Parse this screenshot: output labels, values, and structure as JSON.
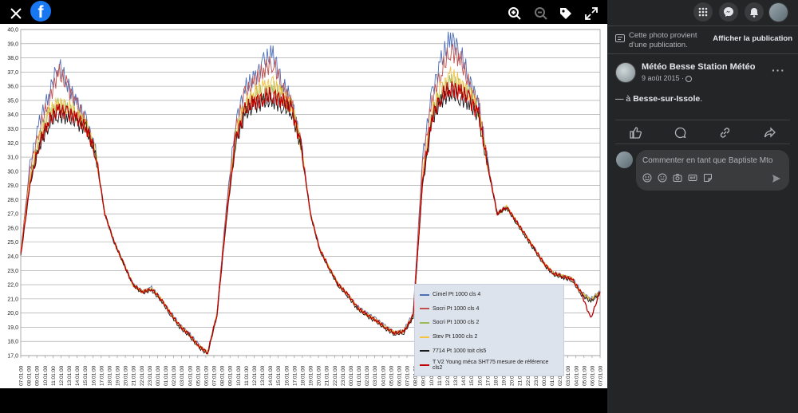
{
  "viewer": {
    "icons": [
      "close-icon",
      "facebook-logo",
      "zoom-in-icon",
      "zoom-out-icon",
      "tag-icon",
      "fullscreen-icon"
    ],
    "logo_letter": "f"
  },
  "panel": {
    "info_text": "Cette photo provient d'une publication.",
    "view_post_label": "Afficher la publication",
    "page_name": "Météo Besse Station Météo",
    "post_date": "9 août 2015 ·",
    "post_text_prefix": "— à ",
    "post_location": "Besse-sur-Issole",
    "post_text_suffix": ".",
    "more_label": "···",
    "comment_placeholder": "Commenter en tant que Baptiste Mto",
    "colors": {
      "panel_bg": "#242526",
      "input_bg": "#3a3b3c",
      "text": "#e4e6eb",
      "muted": "#b0b3b8",
      "brand": "#1877f2"
    }
  },
  "chart_data": {
    "type": "line",
    "ylim": [
      17.0,
      40.0
    ],
    "y_ticks": [
      "17,0",
      "18,0",
      "19,0",
      "20,0",
      "21,0",
      "22,0",
      "23,0",
      "24,0",
      "25,0",
      "26,0",
      "27,0",
      "28,0",
      "29,0",
      "30,0",
      "31,0",
      "32,0",
      "33,0",
      "34,0",
      "35,0",
      "36,0",
      "37,0",
      "38,0",
      "39,0",
      "40,0"
    ],
    "x_ticks": [
      "07:01:00",
      "08:01:00",
      "09:01:00",
      "10:01:00",
      "11:01:00",
      "12:01:00",
      "13:01:00",
      "14:01:00",
      "15:01:00",
      "16:01:00",
      "17:01:00",
      "18:01:00",
      "19:01:00",
      "20:01:00",
      "21:01:00",
      "22:01:00",
      "23:01:00",
      "00:01:00",
      "01:01:00",
      "02:01:00",
      "03:01:00",
      "04:01:00",
      "05:01:00",
      "06:01:00",
      "07:01:00",
      "08:01:00",
      "09:01:00",
      "10:01:00",
      "11:01:00",
      "12:01:00",
      "13:01:00",
      "14:01:00",
      "15:01:00",
      "16:01:00",
      "17:01:00",
      "18:01:00",
      "19:01:00",
      "20:01:00",
      "21:01:00",
      "22:01:00",
      "23:01:00",
      "00:01:00",
      "01:01:00",
      "02:01:00",
      "03:01:00",
      "04:01:00",
      "05:01:00",
      "06:01:00",
      "07:01:00",
      "08:01:00",
      "09:01:00",
      "10:01:00",
      "11:01:00",
      "12:01:00",
      "13:01:00",
      "14:01:00",
      "15:01:00",
      "16:01:00",
      "17:01:00",
      "18:01:00",
      "19:01:00",
      "20:01:00",
      "21:01:00",
      "22:01:00",
      "23:01:00",
      "00:01:00",
      "01:01:00",
      "02:01:00",
      "03:01:00",
      "04:01:00",
      "05:01:00",
      "06:01:00",
      "07:01:00"
    ],
    "grid": true,
    "legend_position": "bottom-right",
    "series": [
      {
        "name": "Cimel Pt 1000 cls 4",
        "color": "#4f6fb8",
        "values": [
          24.3,
          30.5,
          33.5,
          35.4,
          37.6,
          36.2,
          34.8,
          33.6,
          31.5,
          27.0,
          25.0,
          23.5,
          22.0,
          21.5,
          21.8,
          21.0,
          20.1,
          19.2,
          18.6,
          17.8,
          17.2,
          20.0,
          27.5,
          33.5,
          35.9,
          36.5,
          37.7,
          38.3,
          36.2,
          35.0,
          32.0,
          27.0,
          24.5,
          23.2,
          22.0,
          21.3,
          20.5,
          20.0,
          19.6,
          19.1,
          18.6,
          18.8,
          20.0,
          31.0,
          35.5,
          37.8,
          39.5,
          38.5,
          36.5,
          34.8,
          30.5,
          27.0,
          27.5,
          26.5,
          25.5,
          24.5,
          23.5,
          22.8,
          22.6,
          22.5,
          21.5,
          21.0,
          21.5
        ]
      },
      {
        "name": "Socri Pt 1000 cls 4",
        "color": "#c0504d",
        "values": [
          24.3,
          30.2,
          33.0,
          35.0,
          37.0,
          36.0,
          34.6,
          33.4,
          31.4,
          27.0,
          25.0,
          23.5,
          22.0,
          21.5,
          21.7,
          21.0,
          20.0,
          19.1,
          18.5,
          17.7,
          17.2,
          20.0,
          27.2,
          33.0,
          35.5,
          36.2,
          37.2,
          37.7,
          35.9,
          34.8,
          31.9,
          27.0,
          24.5,
          23.2,
          22.0,
          21.3,
          20.4,
          19.9,
          19.5,
          19.0,
          18.6,
          18.7,
          19.9,
          30.5,
          35.0,
          37.0,
          38.6,
          38.0,
          36.0,
          34.6,
          30.4,
          27.0,
          27.5,
          26.5,
          25.5,
          24.5,
          23.5,
          22.8,
          22.6,
          22.4,
          21.4,
          20.9,
          21.5
        ]
      },
      {
        "name": "Socri Pt 1000 cls 2",
        "color": "#9bbb59",
        "values": [
          24.2,
          29.5,
          32.3,
          34.0,
          34.6,
          34.4,
          34.0,
          33.2,
          31.3,
          27.0,
          25.0,
          23.5,
          22.0,
          21.5,
          21.7,
          21.0,
          20.0,
          19.1,
          18.5,
          17.7,
          17.2,
          19.9,
          26.8,
          32.5,
          34.6,
          35.3,
          35.6,
          35.8,
          35.2,
          34.5,
          31.8,
          27.0,
          24.5,
          23.2,
          22.0,
          21.3,
          20.4,
          19.9,
          19.5,
          19.0,
          18.6,
          18.7,
          19.8,
          29.5,
          34.0,
          35.6,
          36.3,
          35.9,
          35.4,
          34.2,
          30.3,
          27.0,
          27.5,
          26.5,
          25.5,
          24.5,
          23.5,
          22.8,
          22.6,
          22.4,
          21.4,
          20.9,
          21.5
        ]
      },
      {
        "name": "Stev Pt 1000 cls 2",
        "color": "#f5c342",
        "values": [
          24.2,
          29.6,
          32.4,
          34.1,
          34.8,
          34.6,
          34.1,
          33.3,
          31.3,
          27.0,
          25.0,
          23.5,
          22.0,
          21.5,
          21.7,
          21.0,
          20.0,
          19.1,
          18.5,
          17.7,
          17.2,
          19.9,
          26.9,
          32.6,
          34.8,
          35.5,
          35.9,
          36.1,
          35.4,
          34.6,
          31.8,
          27.0,
          24.5,
          23.2,
          22.0,
          21.3,
          20.4,
          19.9,
          19.5,
          19.0,
          18.6,
          18.7,
          19.8,
          29.7,
          34.2,
          35.9,
          36.7,
          36.2,
          35.6,
          34.3,
          30.3,
          27.0,
          27.5,
          26.5,
          25.5,
          24.5,
          23.5,
          22.8,
          22.6,
          22.4,
          21.4,
          20.9,
          21.5
        ]
      },
      {
        "name": "7714 Pt 1000 toit cls5",
        "color": "#1a1a1a",
        "values": [
          24.0,
          29.0,
          31.8,
          33.3,
          34.0,
          33.8,
          33.4,
          33.0,
          31.2,
          27.0,
          25.0,
          23.5,
          22.0,
          21.4,
          21.6,
          20.9,
          19.9,
          19.0,
          18.4,
          17.6,
          17.1,
          19.8,
          26.5,
          32.0,
          34.0,
          34.6,
          34.9,
          35.0,
          34.6,
          34.2,
          31.7,
          27.0,
          24.4,
          23.1,
          21.9,
          21.2,
          20.3,
          19.8,
          19.4,
          18.9,
          18.5,
          18.6,
          19.7,
          29.0,
          33.5,
          35.0,
          35.6,
          35.2,
          34.8,
          33.8,
          30.2,
          27.0,
          27.4,
          26.4,
          25.4,
          24.4,
          23.4,
          22.7,
          22.5,
          22.3,
          21.3,
          20.8,
          21.4
        ]
      },
      {
        "name": "T V2 Young méca SHT75 mesure de référence cls2",
        "color": "#c00000",
        "values": [
          24.1,
          29.2,
          32.0,
          33.6,
          34.3,
          34.1,
          33.7,
          33.1,
          31.2,
          27.0,
          25.0,
          23.5,
          22.0,
          21.5,
          21.7,
          21.0,
          20.0,
          19.1,
          18.5,
          17.7,
          17.2,
          19.9,
          26.7,
          32.3,
          34.3,
          34.9,
          35.2,
          35.4,
          35.0,
          34.4,
          31.8,
          27.0,
          24.5,
          23.2,
          22.0,
          21.3,
          20.4,
          19.9,
          19.5,
          19.0,
          18.6,
          18.7,
          19.8,
          29.3,
          33.8,
          35.3,
          35.9,
          35.6,
          35.1,
          34.0,
          30.3,
          27.0,
          27.5,
          26.5,
          25.5,
          24.5,
          23.5,
          22.8,
          22.6,
          22.4,
          21.4,
          19.6,
          21.5
        ]
      }
    ]
  }
}
